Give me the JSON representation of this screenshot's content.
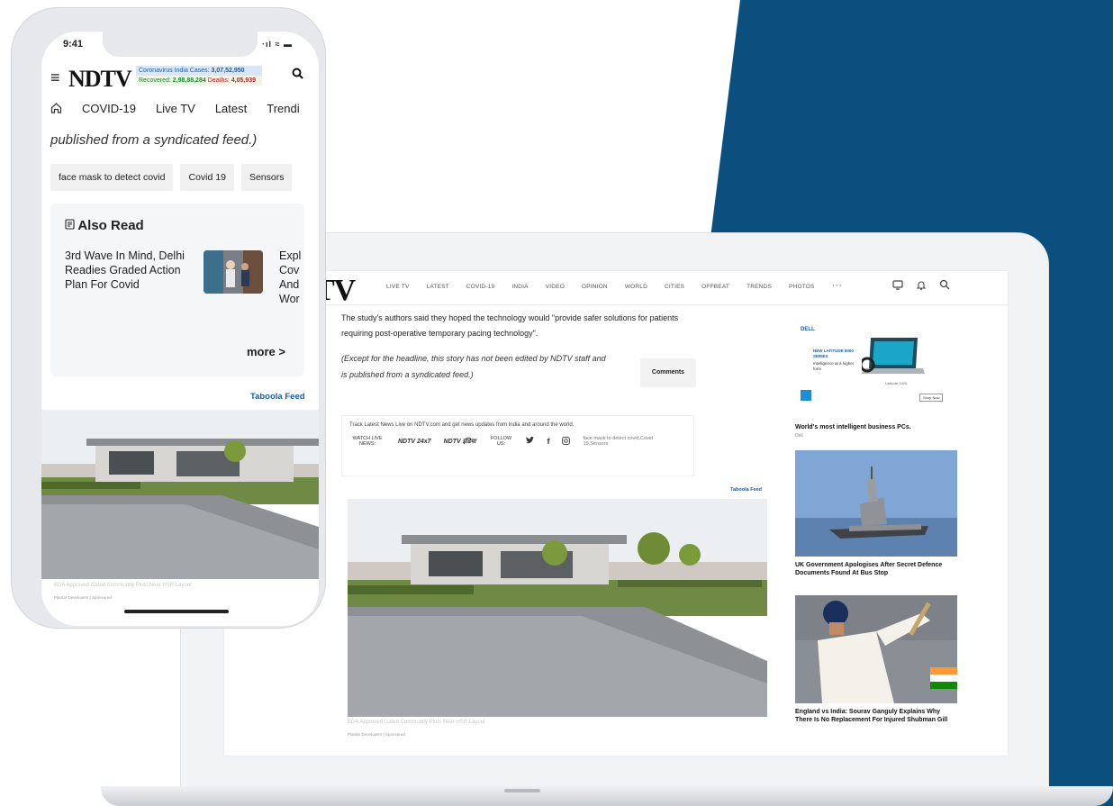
{
  "colors": {
    "backdrop_blue": "#0b4f7e",
    "ndtv_red": "#c8202a",
    "taboola_blue": "#1a5ea8"
  },
  "laptop": {
    "logo": "TV",
    "nav": [
      "LIVE TV",
      "LATEST",
      "COVID-19",
      "INDIA",
      "VIDEO",
      "OPINION",
      "WORLD",
      "CITIES",
      "OFFBEAT",
      "TRENDS",
      "PHOTOS"
    ],
    "nav_more": "···",
    "nav_icons": [
      "tv-icon",
      "bell-icon",
      "search-icon"
    ],
    "article": {
      "para": "The study's authors said they hoped the technology would \"provide safer solutions for patients requiring post-operative temporary pacing technology\".",
      "italic": "(Except for the headline, this story has not been edited by NDTV staff and is published from a syndicated feed.)",
      "comments": "Comments"
    },
    "track": {
      "text": "Track Latest News Live on NDTV.com and get news updates from India and around the world.",
      "watch_live": "WATCH LIVE NEWS:",
      "brand1": "NDTV 24x7",
      "brand2": "NDTV इंडिया",
      "follow": "FOLLOW US:",
      "tags": "face mask to detect covid,Covid 19,Sensors"
    },
    "taboola": "Taboola Feed",
    "hero": {
      "caption": "BDA Approved Gated Community Plots Near HSR Layout",
      "source": "Plantar Developers | Sponsored"
    },
    "sidebar": {
      "ad": {
        "brand": "DELL",
        "headline": "NEW LATITUDE 5000 SERIES",
        "tag": "Intelligence at a higher form",
        "model": "Latitude 5420",
        "cta": "Shop Now"
      },
      "card1": {
        "title": "World's most intelligent business PCs.",
        "sub": "Dell"
      },
      "card2": {
        "title": "UK Government Apologises After Secret Defence Documents Found At Bus Stop"
      },
      "card3": {
        "title": "England vs India: Sourav Ganguly Explains Why There Is No Replacement For Injured Shubman Gill"
      }
    }
  },
  "phone": {
    "time": "9:41",
    "status": "·ıl ≈ ▬",
    "logo": "NDTV",
    "covid": {
      "line1_label": "Coronavirus India Cases:",
      "line1_value": "3,07,52,950",
      "recovered_label": "Recovered:",
      "recovered_value": "2,98,88,284",
      "deaths_label": "Deaths:",
      "deaths_value": "4,05,939"
    },
    "tabs": [
      "COVID-19",
      "Live TV",
      "Latest",
      "Trendi"
    ],
    "italic": "published from a syndicated feed.)",
    "chips": [
      "face mask to detect covid",
      "Covid 19",
      "Sensors"
    ],
    "also_read": {
      "title": "Also Read",
      "story": "3rd Wave In Mind, Delhi Readies Graded Action Plan For Covid",
      "next": "Expl Cov And Wor",
      "more": "more >"
    },
    "taboola": "Taboola Feed",
    "hero": {
      "caption": "BDA Approved Gated Community Plots Near HSR Layout",
      "source": "Plantar Developers | Sponsored"
    }
  }
}
